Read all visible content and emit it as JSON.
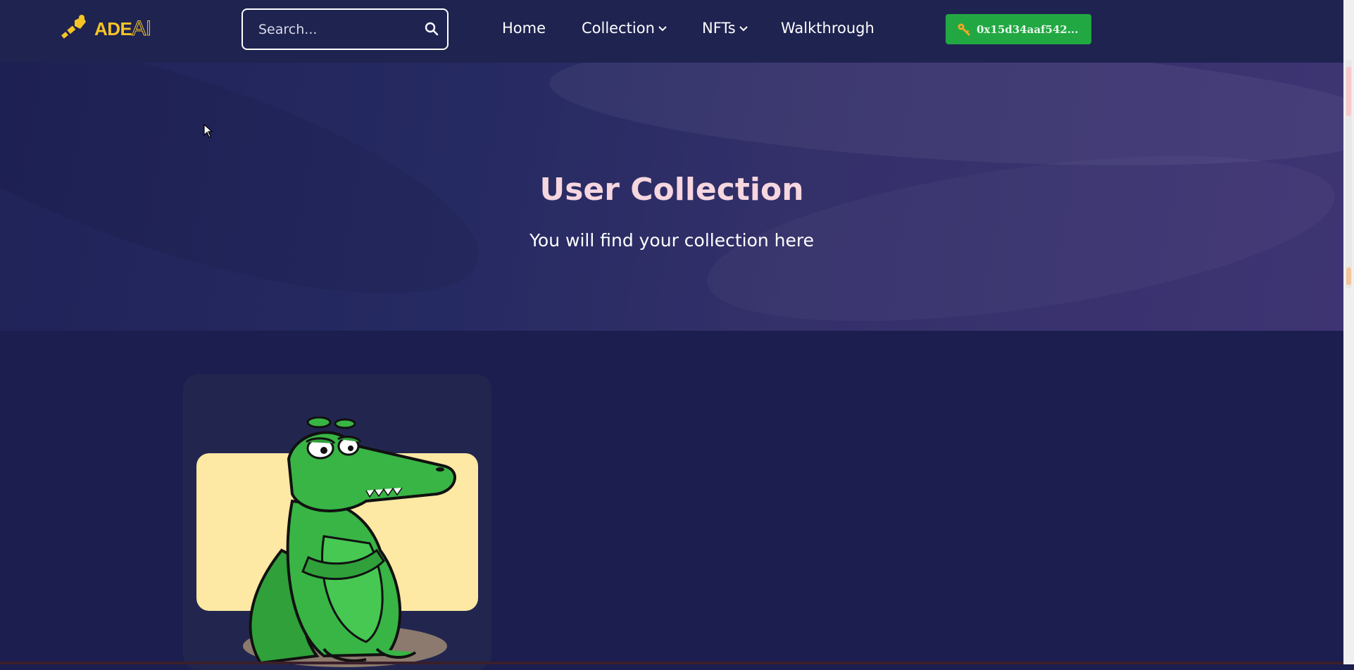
{
  "navbar": {
    "logo": {
      "text_main": "ADE",
      "text_accent": "AI"
    },
    "search": {
      "placeholder": "Search..."
    },
    "items": [
      {
        "label": "Home"
      },
      {
        "label": "Collection"
      },
      {
        "label": "NFTs"
      },
      {
        "label": "Walkthrough"
      }
    ],
    "wallet": {
      "address": "0x15d34aaf542..."
    }
  },
  "hero": {
    "title": "User Collection",
    "subtitle": "You will find your collection here"
  },
  "collection": {
    "cards": [
      {
        "image": "crocodile-nft-image"
      }
    ]
  },
  "colors": {
    "page_bg": "#1b1e4e",
    "navbar_bg": "#1f2350",
    "hero_title": "#f6d6df",
    "wallet_button": "#22a843",
    "logo": "#f5c427"
  },
  "icons": [
    "logo-brush-icon",
    "search-icon",
    "chevron-down-icon",
    "key-icon",
    "cursor-icon"
  ]
}
